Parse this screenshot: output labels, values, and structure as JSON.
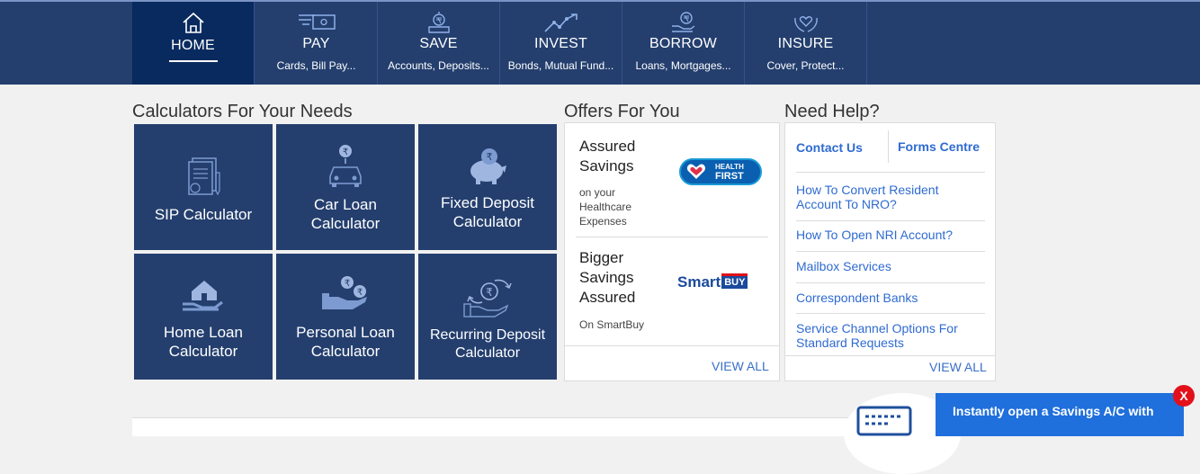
{
  "nav": {
    "items": [
      {
        "label": "HOME",
        "sub": "",
        "icon": "home-icon"
      },
      {
        "label": "PAY",
        "sub": "Cards, Bill Pay...",
        "icon": "card-payment-icon"
      },
      {
        "label": "SAVE",
        "sub": "Accounts, Deposits...",
        "icon": "savings-icon"
      },
      {
        "label": "INVEST",
        "sub": "Bonds, Mutual Fund...",
        "icon": "invest-growth-icon"
      },
      {
        "label": "BORROW",
        "sub": "Loans, Mortgages...",
        "icon": "loan-icon"
      },
      {
        "label": "INSURE",
        "sub": "Cover, Protect...",
        "icon": "insurance-icon"
      }
    ]
  },
  "calculators": {
    "title": "Calculators For Your Needs",
    "items": [
      {
        "line1": "SIP Calculator",
        "line2": "",
        "icon": "document-chart-icon"
      },
      {
        "line1": "Car Loan",
        "line2": "Calculator",
        "icon": "car-rupee-icon"
      },
      {
        "line1": "Fixed Deposit",
        "line2": "Calculator",
        "icon": "piggy-bank-icon"
      },
      {
        "line1": "Home Loan",
        "line2": "Calculator",
        "icon": "house-hand-icon"
      },
      {
        "line1": "Personal Loan",
        "line2": "Calculator",
        "icon": "hand-coins-icon"
      },
      {
        "line1": "Recurring Deposit",
        "line2": "Calculator",
        "icon": "recurring-coin-icon"
      }
    ]
  },
  "offers": {
    "title": "Offers For You",
    "items": [
      {
        "title1": "Assured",
        "title2": "Savings",
        "title3": "",
        "sub1": "on your",
        "sub2": "Healthcare",
        "sub3": "Expenses",
        "logo_line1": "HEALTH",
        "logo_line2": "FIRST"
      },
      {
        "title1": "Bigger",
        "title2": "Savings",
        "title3": "Assured",
        "sub1": "On SmartBuy",
        "sub2": "",
        "sub3": "",
        "logo_line1": "Smart",
        "logo_line2": "BUY"
      }
    ],
    "view_all": "VIEW ALL"
  },
  "help": {
    "title": "Need Help?",
    "contact": "Contact Us",
    "forms": "Forms Centre",
    "links": [
      {
        "line1": "How To Convert Resident",
        "line2": "Account To NRO?"
      },
      {
        "line1": "How To Open NRI Account?",
        "line2": ""
      },
      {
        "line1": "Mailbox Services",
        "line2": ""
      },
      {
        "line1": "Correspondent Banks",
        "line2": ""
      },
      {
        "line1": "Service Channel Options For",
        "line2": "Standard Requests"
      }
    ],
    "view_all": "VIEW ALL"
  },
  "banner": {
    "text": "Instantly open a Savings A/C with",
    "close": "X"
  },
  "colors": {
    "nav_bg": "#243f6e",
    "nav_active": "#082a5e",
    "tile_bg": "#243f6e",
    "link": "#2f6bd1",
    "banner": "#1f6fdc",
    "close": "#e2101a"
  }
}
